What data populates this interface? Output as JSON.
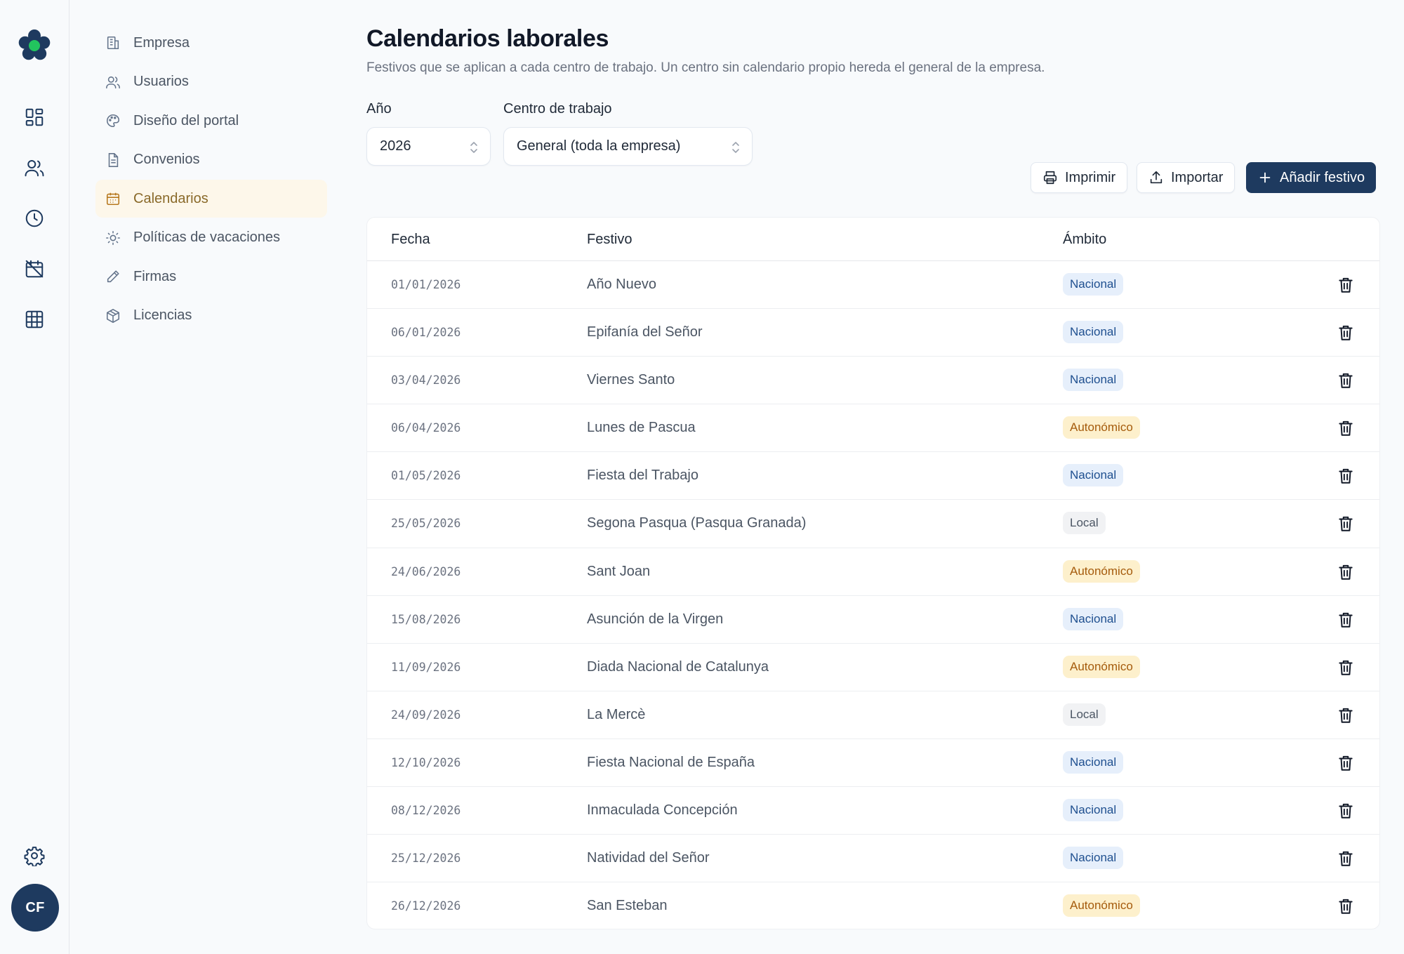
{
  "nav": {
    "items": [
      {
        "label": "Empresa",
        "icon": "building-icon"
      },
      {
        "label": "Usuarios",
        "icon": "users-icon"
      },
      {
        "label": "Diseño del portal",
        "icon": "palette-icon"
      },
      {
        "label": "Convenios",
        "icon": "document-icon"
      },
      {
        "label": "Calendarios",
        "icon": "calendar-icon",
        "active": true
      },
      {
        "label": "Políticas de vacaciones",
        "icon": "sun-icon"
      },
      {
        "label": "Firmas",
        "icon": "pen-icon"
      },
      {
        "label": "Licencias",
        "icon": "package-icon"
      }
    ]
  },
  "user": {
    "initials": "CF"
  },
  "header": {
    "title": "Calendarios laborales",
    "subtitle": "Festivos que se aplican a cada centro de trabajo. Un centro sin calendario propio hereda el general de la empresa."
  },
  "filters": {
    "year_label": "Año",
    "year_value": "2026",
    "center_label": "Centro de trabajo",
    "center_value": "General (toda la empresa)"
  },
  "actions": {
    "print": "Imprimir",
    "import": "Importar",
    "add": "Añadir festivo"
  },
  "table": {
    "columns": [
      "Fecha",
      "Festivo",
      "Ámbito"
    ],
    "rows": [
      {
        "date": "01/01/2026",
        "name": "Año Nuevo",
        "scope": "Nacional",
        "kind": "nacional"
      },
      {
        "date": "06/01/2026",
        "name": "Epifanía del Señor",
        "scope": "Nacional",
        "kind": "nacional"
      },
      {
        "date": "03/04/2026",
        "name": "Viernes Santo",
        "scope": "Nacional",
        "kind": "nacional"
      },
      {
        "date": "06/04/2026",
        "name": "Lunes de Pascua",
        "scope": "Autonómico",
        "kind": "autonomico"
      },
      {
        "date": "01/05/2026",
        "name": "Fiesta del Trabajo",
        "scope": "Nacional",
        "kind": "nacional"
      },
      {
        "date": "25/05/2026",
        "name": "Segona Pasqua (Pasqua Granada)",
        "scope": "Local",
        "kind": "local"
      },
      {
        "date": "24/06/2026",
        "name": "Sant Joan",
        "scope": "Autonómico",
        "kind": "autonomico"
      },
      {
        "date": "15/08/2026",
        "name": "Asunción de la Virgen",
        "scope": "Nacional",
        "kind": "nacional"
      },
      {
        "date": "11/09/2026",
        "name": "Diada Nacional de Catalunya",
        "scope": "Autonómico",
        "kind": "autonomico"
      },
      {
        "date": "24/09/2026",
        "name": "La Mercè",
        "scope": "Local",
        "kind": "local"
      },
      {
        "date": "12/10/2026",
        "name": "Fiesta Nacional de España",
        "scope": "Nacional",
        "kind": "nacional"
      },
      {
        "date": "08/12/2026",
        "name": "Inmaculada Concepción",
        "scope": "Nacional",
        "kind": "nacional"
      },
      {
        "date": "25/12/2026",
        "name": "Natividad del Señor",
        "scope": "Nacional",
        "kind": "nacional"
      },
      {
        "date": "26/12/2026",
        "name": "San Esteban",
        "scope": "Autonómico",
        "kind": "autonomico"
      }
    ]
  },
  "colors": {
    "brand": "#1e3a5f",
    "accent_green": "#22c55e",
    "active_nav_bg": "#fdf7ea",
    "badge_nacional": "#e6effb",
    "badge_autonomico": "#fdf0cc",
    "badge_local": "#f1f2f4"
  }
}
